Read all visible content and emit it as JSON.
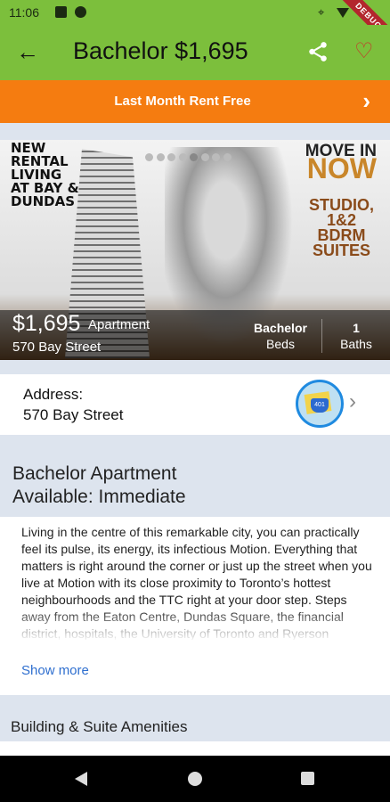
{
  "status_bar": {
    "time": "11:06",
    "debug_banner": "DEBUG"
  },
  "app_bar": {
    "title": "Bachelor $1,695",
    "back_icon": "arrow-left-icon",
    "share_icon": "share-icon",
    "favorite_icon": "heart-outline-icon"
  },
  "promo_banner": {
    "text": "Last Month Rent Free",
    "chevron_icon": "chevron-right-icon"
  },
  "hero": {
    "headline_left": "NEW\nRENTAL\nLIVING\nAT BAY &\nDUNDAS",
    "headline_move_in": "MOVE IN",
    "headline_now": "NOW",
    "headline_suites": "STUDIO,\n1&2\nBDRM\nSUITES",
    "carousel_dot_count": 8,
    "carousel_active_index": 4,
    "price": "$1,695",
    "type": "Apartment",
    "street": "570 Bay Street",
    "beds_value": "Bachelor",
    "beds_label": "Beds",
    "baths_value": "1",
    "baths_label": "Baths"
  },
  "address": {
    "label": "Address:",
    "value": "570 Bay Street",
    "map_icon": "map-icon",
    "chevron_icon": "chevron-right-icon"
  },
  "availability": {
    "line1": "Bachelor Apartment",
    "line2": "Available: Immediate"
  },
  "description": {
    "text": "Living in the centre of this remarkable city, you can practically feel its pulse, its energy, its infectious Motion. Everything that matters is right around the corner or just up the street when you live at Motion with its close proximity to Toronto’s hottest neighbourhoods and the TTC right at your door step. Steps away from the Eaton Centre, Dundas Square, the financial district, hospitals, the University of Toronto and Ryerson University, Motion",
    "show_more": "Show more"
  },
  "amenities": {
    "title": "Building & Suite Amenities"
  }
}
